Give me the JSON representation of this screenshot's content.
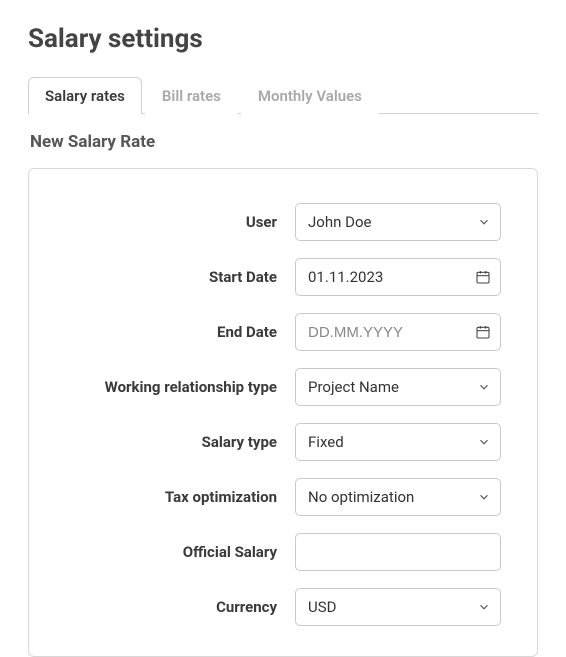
{
  "page_title": "Salary settings",
  "tabs": {
    "rates": "Salary rates",
    "bill": "Bill rates",
    "monthly": "Monthly Values"
  },
  "section_title": "New Salary Rate",
  "labels": {
    "user": "User",
    "start_date": "Start Date",
    "end_date": "End Date",
    "relationship": "Working relationship type",
    "salary_type": "Salary type",
    "tax_opt": "Tax optimization",
    "official_salary": "Official Salary",
    "currency": "Currency"
  },
  "values": {
    "user": "John Doe",
    "start_date": "01.11.2023",
    "end_date_placeholder": "DD.MM.YYYY",
    "relationship": "Project Name",
    "salary_type": "Fixed",
    "tax_opt": "No optimization",
    "official_salary": "",
    "currency": "USD"
  }
}
